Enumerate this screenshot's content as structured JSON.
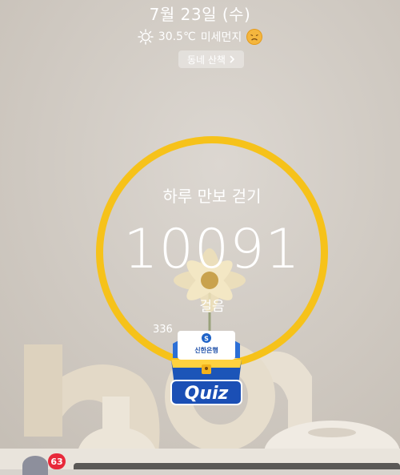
{
  "header": {
    "date": "7월 23일 (수)",
    "weather_icon": "sun-icon",
    "temperature": "30.5℃",
    "dust_label": "미세먼지",
    "dust_status_icon": "frown-face-icon",
    "walk_button_label": "동네 산책"
  },
  "pedometer": {
    "goal_title": "하루 만보 걷기",
    "step_count": "10091",
    "unit_label": "걸음",
    "sub_stats_visible": "336",
    "ring_color": "#f6c21a"
  },
  "promo": {
    "bank_name": "신한은행",
    "quiz_label": "Quiz"
  },
  "footer": {
    "notification_count": "63"
  }
}
